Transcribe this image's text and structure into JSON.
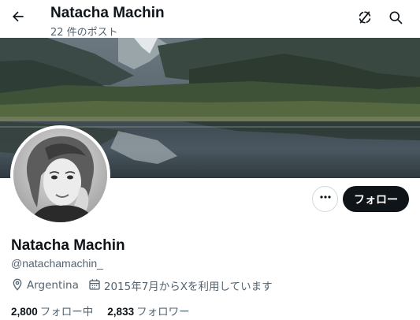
{
  "header": {
    "name": "Natacha Machin",
    "post_count": "22 件のポスト",
    "icons": [
      "back-arrow-icon",
      "timeline-toggle-icon",
      "search-icon"
    ]
  },
  "profile": {
    "name": "Natacha Machin",
    "handle": "@natachamachin_",
    "location": "Argentina",
    "joined": "2015年7月からXを利用しています"
  },
  "actions": {
    "more_label": "•••",
    "follow_label": "フォロー"
  },
  "stats": {
    "following_count": "2,800",
    "following_label": "フォロー中",
    "followers_count": "2,833",
    "followers_label": "フォロワー"
  },
  "colors": {
    "text_primary": "#0f1419",
    "text_secondary": "#536471",
    "follow_button_bg": "#0f1419",
    "follow_button_text": "#ffffff",
    "border": "#cfd9de"
  }
}
